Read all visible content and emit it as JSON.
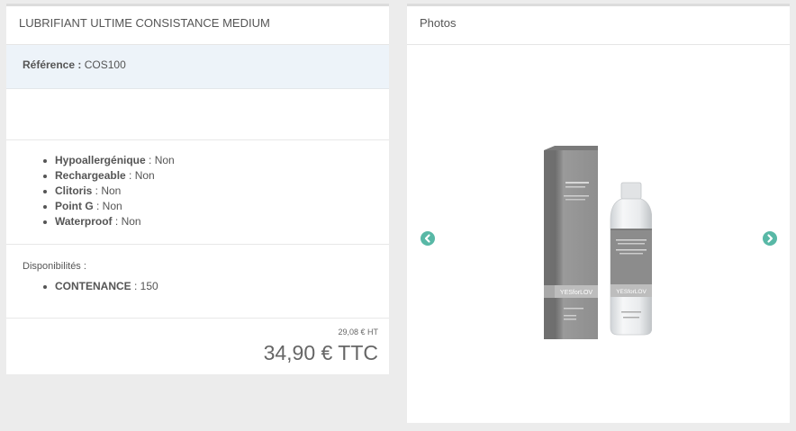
{
  "product": {
    "title": "LUBRIFIANT ULTIME CONSISTANCE MEDIUM",
    "reference_label": "Référence :",
    "reference_value": "COS100",
    "features": [
      {
        "label": "Hypoallergénique",
        "value": " : Non"
      },
      {
        "label": "Rechargeable",
        "value": " : Non"
      },
      {
        "label": "Clitoris",
        "value": " : Non"
      },
      {
        "label": "Point G",
        "value": " : Non"
      },
      {
        "label": "Waterproof",
        "value": " : Non"
      }
    ],
    "availability": {
      "title": "Disponibilités :",
      "items": [
        {
          "label": "CONTENANCE",
          "value": " : 150"
        }
      ]
    },
    "price_ht": "29,08 € HT",
    "price_ttc": "34,90 € TTC"
  },
  "photos": {
    "title": "Photos",
    "image_label": "YESforLOV",
    "icons": {
      "prev": "chevron-left-icon",
      "next": "chevron-right-icon"
    }
  },
  "colors": {
    "accent": "#58b8a6",
    "ref_background": "#edf3f9",
    "page_background": "#ececec"
  }
}
